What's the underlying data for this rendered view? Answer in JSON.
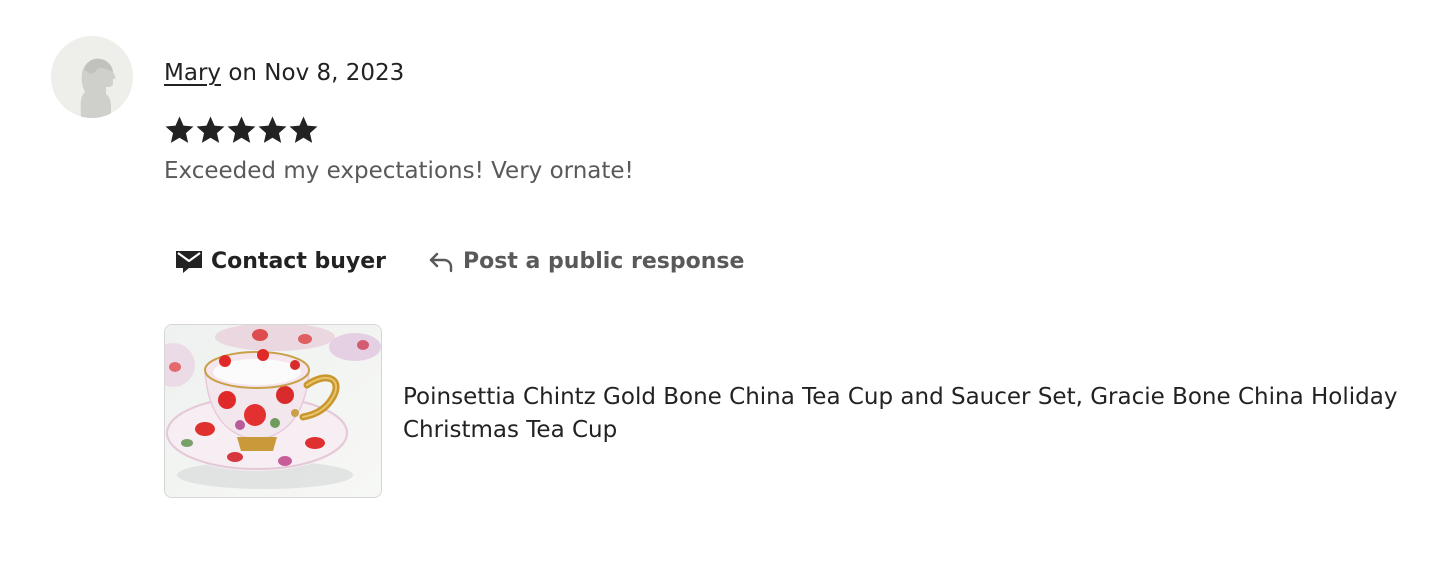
{
  "review": {
    "reviewer_name": "Mary",
    "date_text": "on Nov 8, 2023",
    "rating": 5,
    "text": "Exceeded my expectations! Very ornate!"
  },
  "actions": {
    "contact_label": "Contact buyer",
    "response_label": "Post a public response"
  },
  "product": {
    "title": "Poinsettia Chintz Gold Bone China Tea Cup and Saucer Set, Gracie Bone China Holiday Christmas Tea Cup"
  },
  "icons": {
    "avatar": "default-user-silhouette",
    "star": "star-icon",
    "contact": "envelope-chat-icon",
    "response": "reply-arrow-icon"
  },
  "colors": {
    "star": "#222222",
    "text_primary": "#222222",
    "text_secondary": "#595959",
    "avatar_bg": "#eeeeea"
  }
}
